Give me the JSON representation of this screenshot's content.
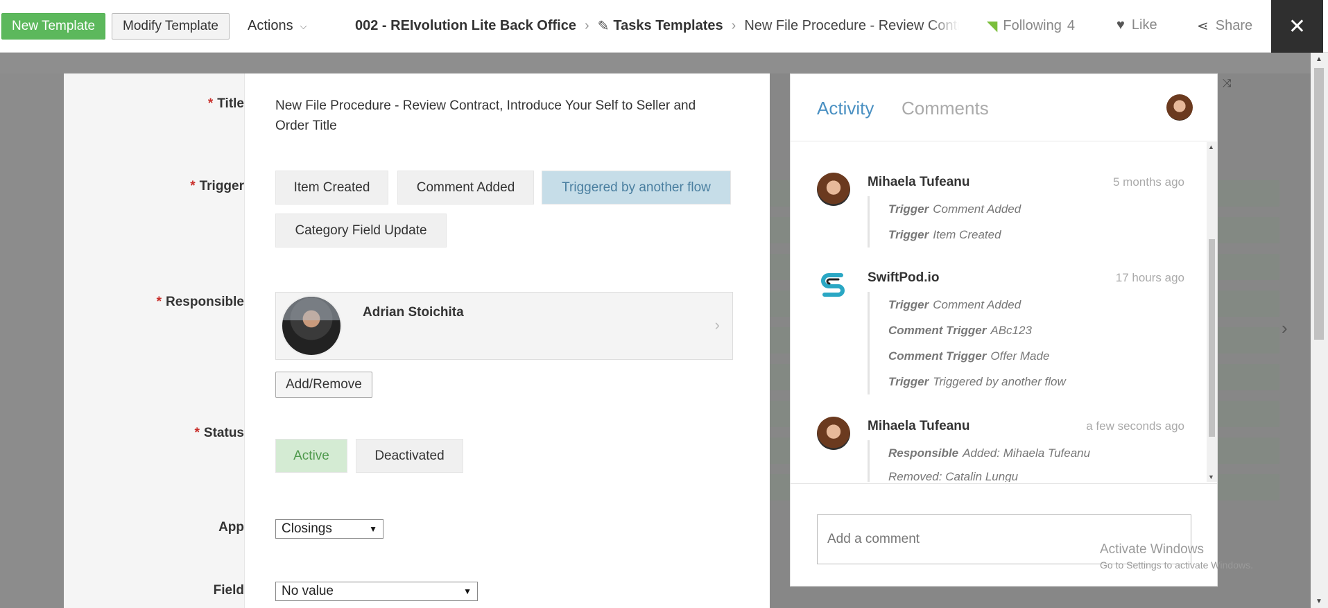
{
  "topbar": {
    "new_template": "New Template",
    "modify_template": "Modify Template",
    "actions": "Actions",
    "breadcrumb": {
      "workspace": "002 - REIvolution Lite Back Office",
      "app": "Tasks Templates",
      "item": "New File Procedure - Review Contract, Introduce Your Self to Seller and Order Title"
    },
    "following_label": "Following",
    "following_count": "4",
    "like": "Like",
    "share": "Share",
    "close": "✕"
  },
  "form": {
    "title_label": "Title",
    "title_value": "New File Procedure - Review Contract, Introduce Your Self to Seller and Order Title",
    "trigger_label": "Trigger",
    "trigger_options": [
      "Item Created",
      "Comment Added",
      "Triggered by another flow",
      "Category Field Update"
    ],
    "trigger_selected": "Triggered by another flow",
    "responsible_label": "Responsible",
    "responsible_name": "Adrian Stoichita",
    "add_remove": "Add/Remove",
    "status_label": "Status",
    "status_options": [
      "Active",
      "Deactivated"
    ],
    "status_selected": "Active",
    "app_label": "App",
    "app_value": "Closings",
    "field_label": "Field",
    "field_value": "No value"
  },
  "activity": {
    "tab_activity": "Activity",
    "tab_comments": "Comments",
    "entries": [
      {
        "name": "Mihaela Tufeanu",
        "time": "5 months ago",
        "lines": [
          {
            "key": "Trigger",
            "value": "Comment Added"
          },
          {
            "key": "Trigger",
            "value": "Item Created"
          }
        ]
      },
      {
        "name": "SwiftPod.io",
        "time": "17 hours ago",
        "lines": [
          {
            "key": "Trigger",
            "value": "Comment Added"
          },
          {
            "key": "Comment Trigger",
            "value": "ABc123"
          },
          {
            "key": "Comment Trigger",
            "value": "Offer Made"
          },
          {
            "key": "Trigger",
            "value": "Triggered by another flow"
          }
        ]
      },
      {
        "name": "Mihaela Tufeanu",
        "time": "a few seconds ago",
        "lines": [
          {
            "key": "Responsible",
            "value": "Added: Mihaela Tufeanu"
          },
          {
            "key": "",
            "value": "Removed: Catalin Lungu"
          }
        ]
      }
    ],
    "comment_placeholder": "Add a comment"
  },
  "watermark": {
    "line1": "Activate Windows",
    "line2": "Go to Settings to activate Windows."
  },
  "icons": {
    "rss": "rss-icon",
    "heart": "heart-icon",
    "share": "share-icon",
    "wand": "magic-wand-icon",
    "close": "close-icon"
  },
  "colors": {
    "new_button": "#5cb85c",
    "selected_trigger": "#c6dde8",
    "selected_status": "#d4ebd3",
    "activity_tab": "#4a90c2",
    "required": "#c9302c"
  }
}
